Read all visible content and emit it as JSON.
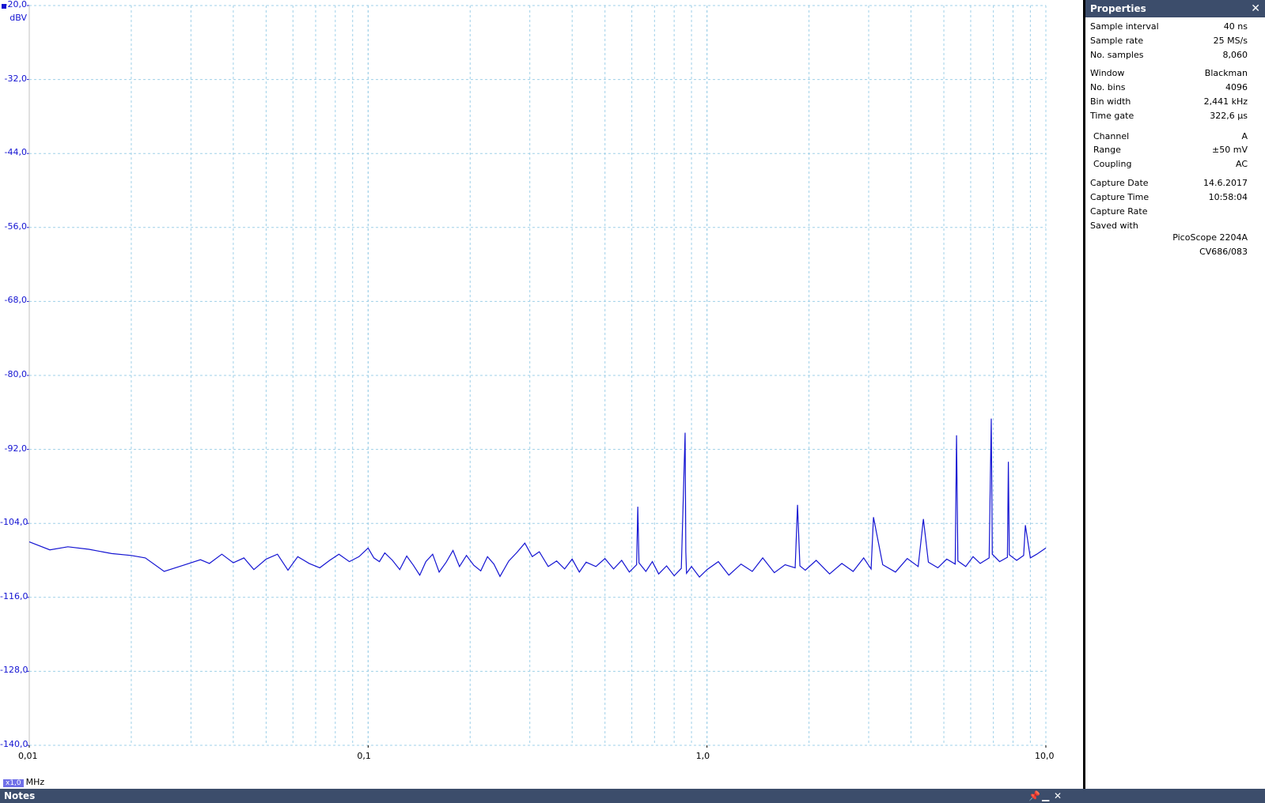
{
  "chart_data": {
    "type": "line",
    "x_scale": "log",
    "xlim": [
      0.01,
      10.0
    ],
    "ylim": [
      -140.0,
      -20.0
    ],
    "yunit": "dBV",
    "xunit": "MHz",
    "x_ticks": [
      "0,01",
      "0,1",
      "1,0",
      "10,0"
    ],
    "y_ticks": [
      "-20,0",
      "-32,0",
      "-44,0",
      "-56,0",
      "-68,0",
      "-80,0",
      "-92,0",
      "-104,0",
      "-116,0",
      "-128,0",
      "-140,0"
    ],
    "grid": true,
    "series_color": "#1414d2",
    "series": [
      {
        "x": [
          0.01,
          0.0115,
          0.013,
          0.015,
          0.0175,
          0.02,
          0.022,
          0.025,
          0.0285,
          0.032,
          0.034,
          0.037,
          0.04,
          0.043,
          0.046,
          0.05,
          0.054,
          0.058,
          0.062,
          0.067,
          0.072,
          0.077,
          0.082,
          0.088,
          0.094,
          0.1,
          0.104,
          0.108,
          0.112,
          0.118,
          0.124,
          0.13,
          0.136,
          0.142,
          0.148,
          0.155,
          0.162,
          0.17,
          0.178,
          0.186,
          0.195,
          0.205,
          0.215,
          0.225,
          0.235,
          0.245,
          0.26,
          0.275,
          0.29,
          0.305,
          0.32,
          0.34,
          0.36,
          0.38,
          0.4,
          0.42,
          0.44,
          0.47,
          0.5,
          0.53,
          0.56,
          0.59,
          0.62,
          0.625,
          0.63,
          0.66,
          0.69,
          0.72,
          0.76,
          0.8,
          0.84,
          0.862,
          0.866,
          0.87,
          0.9,
          0.95,
          1.0,
          1.08,
          1.16,
          1.26,
          1.36,
          1.46,
          1.58,
          1.7,
          1.82,
          1.85,
          1.88,
          1.95,
          2.1,
          2.3,
          2.5,
          2.7,
          2.9,
          3.05,
          3.1,
          3.3,
          3.6,
          3.9,
          4.2,
          4.35,
          4.5,
          4.8,
          5.1,
          5.4,
          5.45,
          5.5,
          5.8,
          6.1,
          6.4,
          6.8,
          6.9,
          6.95,
          7.3,
          7.7,
          7.75,
          7.8,
          8.2,
          8.6,
          8.7,
          9.0,
          9.4,
          10.0
        ],
        "y": [
          -107.0,
          -108.3,
          -107.8,
          -108.2,
          -108.9,
          -109.2,
          -109.6,
          -111.8,
          -110.8,
          -109.9,
          -110.5,
          -109.0,
          -110.4,
          -109.6,
          -111.5,
          -109.8,
          -109.0,
          -111.6,
          -109.4,
          -110.5,
          -111.2,
          -110.0,
          -109.0,
          -110.2,
          -109.4,
          -108.0,
          -109.6,
          -110.2,
          -108.8,
          -110.0,
          -111.5,
          -109.3,
          -110.8,
          -112.4,
          -110.2,
          -109.0,
          -111.9,
          -110.3,
          -108.4,
          -111.0,
          -109.2,
          -110.8,
          -111.7,
          -109.4,
          -110.6,
          -112.6,
          -110.1,
          -108.7,
          -107.2,
          -109.4,
          -108.6,
          -111.0,
          -110.1,
          -111.4,
          -109.8,
          -111.9,
          -110.3,
          -111.0,
          -109.7,
          -111.4,
          -110.0,
          -111.9,
          -110.7,
          -101.3,
          -110.4,
          -111.8,
          -110.2,
          -112.2,
          -110.9,
          -112.5,
          -111.3,
          -89.3,
          -108.6,
          -112.1,
          -111.0,
          -112.7,
          -111.5,
          -110.2,
          -112.4,
          -110.6,
          -111.8,
          -109.6,
          -112.0,
          -110.7,
          -111.2,
          -101.0,
          -110.9,
          -111.6,
          -110.0,
          -112.2,
          -110.5,
          -111.8,
          -109.6,
          -111.4,
          -103.0,
          -110.7,
          -111.9,
          -109.7,
          -111.0,
          -103.3,
          -110.3,
          -111.2,
          -109.8,
          -110.6,
          -89.7,
          -110.1,
          -111.0,
          -109.4,
          -110.5,
          -109.6,
          -87.0,
          -109.0,
          -110.2,
          -109.5,
          -94.0,
          -109.1,
          -110.0,
          -109.2,
          -104.3,
          -109.6,
          -109.0,
          -108.0
        ]
      }
    ]
  },
  "properties": {
    "title": "Properties",
    "close_icon": "close-icon",
    "rows": [
      {
        "k": "Sample interval",
        "v": "40 ns"
      },
      {
        "k": "Sample rate",
        "v": "25 MS/s"
      },
      {
        "k": "No. samples",
        "v": "8,060"
      },
      {
        "k": "Window",
        "v": "Blackman"
      },
      {
        "k": "No. bins",
        "v": "4096"
      },
      {
        "k": "Bin width",
        "v": "2,441 kHz"
      },
      {
        "k": "Time gate",
        "v": "322,6 µs"
      },
      {
        "k": "Channel",
        "v": "A"
      },
      {
        "k": "Range",
        "v": "±50 mV"
      },
      {
        "k": "Coupling",
        "v": "AC"
      },
      {
        "k": "Capture Date",
        "v": "14.6.2017"
      },
      {
        "k": "Capture Time",
        "v": "10:58:04"
      },
      {
        "k": "Capture Rate",
        "v": ""
      },
      {
        "k": "Saved with",
        "v": ""
      }
    ],
    "saved_with_lines": [
      "PicoScope 2204A",
      "CV686/083"
    ]
  },
  "x_zoom_badge": "x1,0",
  "notes": {
    "title": "Notes",
    "pin_icon": "pin-icon",
    "minimize_icon": "minimize-icon",
    "close_icon": "close-icon"
  }
}
